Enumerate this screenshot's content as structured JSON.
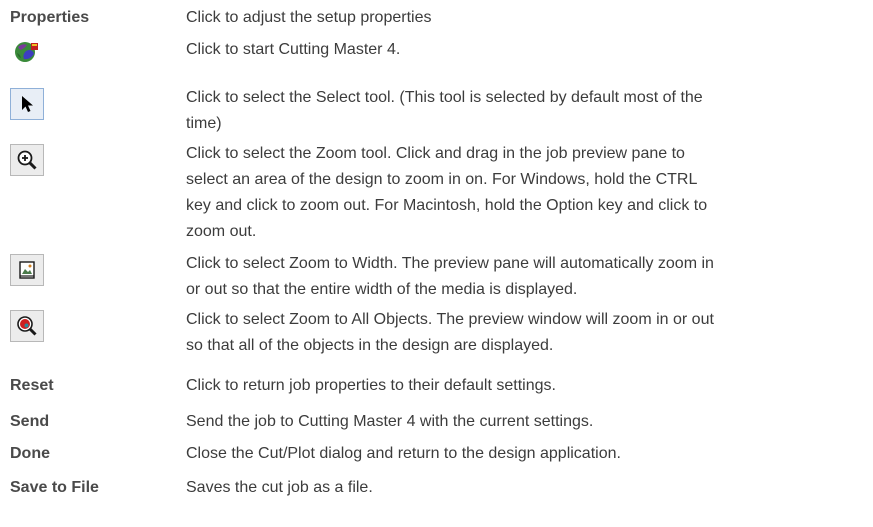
{
  "rows": [
    {
      "term": "Properties",
      "desc": "Click to adjust the setup properties"
    },
    {
      "icon": "cutting-master-globe-icon",
      "desc": "Click to start Cutting Master 4."
    },
    {
      "icon": "select-arrow-icon",
      "desc_lines": [
        "Click to select the Select tool. (This tool is selected by default most of the",
        "time)"
      ]
    },
    {
      "icon": "zoom-tool-icon",
      "desc_lines": [
        "Click to select the Zoom tool. Click and drag in the job preview pane to",
        "select an area of the design to zoom in on. For Windows, hold the CTRL",
        "key and click to zoom out. For Macintosh, hold the Option key and click to",
        "zoom out."
      ]
    },
    {
      "icon": "zoom-to-width-icon",
      "desc_lines": [
        "Click to select Zoom to Width. The preview pane will automatically zoom in",
        "or out so that the entire width of the media is displayed."
      ]
    },
    {
      "icon": "zoom-to-all-objects-icon",
      "desc_lines": [
        "Click to select Zoom to All Objects. The preview window will zoom in or out",
        "so that all of the objects in the design are displayed."
      ]
    },
    {
      "term": "Reset",
      "desc": "Click to return job properties to their default settings."
    },
    {
      "term": "Send",
      "desc": "Send the job to Cutting Master 4 with the current settings."
    },
    {
      "term": "Done",
      "desc": "Close the Cut/Plot dialog and return to the design application."
    },
    {
      "term": "Save to File",
      "desc": "Saves the cut job as a file."
    }
  ]
}
